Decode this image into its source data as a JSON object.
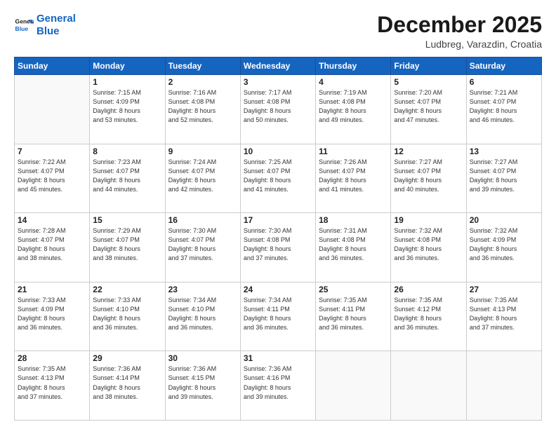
{
  "header": {
    "logo_line1": "General",
    "logo_line2": "Blue",
    "month": "December 2025",
    "location": "Ludbreg, Varazdin, Croatia"
  },
  "weekdays": [
    "Sunday",
    "Monday",
    "Tuesday",
    "Wednesday",
    "Thursday",
    "Friday",
    "Saturday"
  ],
  "weeks": [
    [
      {
        "day": "",
        "info": ""
      },
      {
        "day": "1",
        "info": "Sunrise: 7:15 AM\nSunset: 4:09 PM\nDaylight: 8 hours\nand 53 minutes."
      },
      {
        "day": "2",
        "info": "Sunrise: 7:16 AM\nSunset: 4:08 PM\nDaylight: 8 hours\nand 52 minutes."
      },
      {
        "day": "3",
        "info": "Sunrise: 7:17 AM\nSunset: 4:08 PM\nDaylight: 8 hours\nand 50 minutes."
      },
      {
        "day": "4",
        "info": "Sunrise: 7:19 AM\nSunset: 4:08 PM\nDaylight: 8 hours\nand 49 minutes."
      },
      {
        "day": "5",
        "info": "Sunrise: 7:20 AM\nSunset: 4:07 PM\nDaylight: 8 hours\nand 47 minutes."
      },
      {
        "day": "6",
        "info": "Sunrise: 7:21 AM\nSunset: 4:07 PM\nDaylight: 8 hours\nand 46 minutes."
      }
    ],
    [
      {
        "day": "7",
        "info": "Sunrise: 7:22 AM\nSunset: 4:07 PM\nDaylight: 8 hours\nand 45 minutes."
      },
      {
        "day": "8",
        "info": "Sunrise: 7:23 AM\nSunset: 4:07 PM\nDaylight: 8 hours\nand 44 minutes."
      },
      {
        "day": "9",
        "info": "Sunrise: 7:24 AM\nSunset: 4:07 PM\nDaylight: 8 hours\nand 42 minutes."
      },
      {
        "day": "10",
        "info": "Sunrise: 7:25 AM\nSunset: 4:07 PM\nDaylight: 8 hours\nand 41 minutes."
      },
      {
        "day": "11",
        "info": "Sunrise: 7:26 AM\nSunset: 4:07 PM\nDaylight: 8 hours\nand 41 minutes."
      },
      {
        "day": "12",
        "info": "Sunrise: 7:27 AM\nSunset: 4:07 PM\nDaylight: 8 hours\nand 40 minutes."
      },
      {
        "day": "13",
        "info": "Sunrise: 7:27 AM\nSunset: 4:07 PM\nDaylight: 8 hours\nand 39 minutes."
      }
    ],
    [
      {
        "day": "14",
        "info": "Sunrise: 7:28 AM\nSunset: 4:07 PM\nDaylight: 8 hours\nand 38 minutes."
      },
      {
        "day": "15",
        "info": "Sunrise: 7:29 AM\nSunset: 4:07 PM\nDaylight: 8 hours\nand 38 minutes."
      },
      {
        "day": "16",
        "info": "Sunrise: 7:30 AM\nSunset: 4:07 PM\nDaylight: 8 hours\nand 37 minutes."
      },
      {
        "day": "17",
        "info": "Sunrise: 7:30 AM\nSunset: 4:08 PM\nDaylight: 8 hours\nand 37 minutes."
      },
      {
        "day": "18",
        "info": "Sunrise: 7:31 AM\nSunset: 4:08 PM\nDaylight: 8 hours\nand 36 minutes."
      },
      {
        "day": "19",
        "info": "Sunrise: 7:32 AM\nSunset: 4:08 PM\nDaylight: 8 hours\nand 36 minutes."
      },
      {
        "day": "20",
        "info": "Sunrise: 7:32 AM\nSunset: 4:09 PM\nDaylight: 8 hours\nand 36 minutes."
      }
    ],
    [
      {
        "day": "21",
        "info": "Sunrise: 7:33 AM\nSunset: 4:09 PM\nDaylight: 8 hours\nand 36 minutes."
      },
      {
        "day": "22",
        "info": "Sunrise: 7:33 AM\nSunset: 4:10 PM\nDaylight: 8 hours\nand 36 minutes."
      },
      {
        "day": "23",
        "info": "Sunrise: 7:34 AM\nSunset: 4:10 PM\nDaylight: 8 hours\nand 36 minutes."
      },
      {
        "day": "24",
        "info": "Sunrise: 7:34 AM\nSunset: 4:11 PM\nDaylight: 8 hours\nand 36 minutes."
      },
      {
        "day": "25",
        "info": "Sunrise: 7:35 AM\nSunset: 4:11 PM\nDaylight: 8 hours\nand 36 minutes."
      },
      {
        "day": "26",
        "info": "Sunrise: 7:35 AM\nSunset: 4:12 PM\nDaylight: 8 hours\nand 36 minutes."
      },
      {
        "day": "27",
        "info": "Sunrise: 7:35 AM\nSunset: 4:13 PM\nDaylight: 8 hours\nand 37 minutes."
      }
    ],
    [
      {
        "day": "28",
        "info": "Sunrise: 7:35 AM\nSunset: 4:13 PM\nDaylight: 8 hours\nand 37 minutes."
      },
      {
        "day": "29",
        "info": "Sunrise: 7:36 AM\nSunset: 4:14 PM\nDaylight: 8 hours\nand 38 minutes."
      },
      {
        "day": "30",
        "info": "Sunrise: 7:36 AM\nSunset: 4:15 PM\nDaylight: 8 hours\nand 39 minutes."
      },
      {
        "day": "31",
        "info": "Sunrise: 7:36 AM\nSunset: 4:16 PM\nDaylight: 8 hours\nand 39 minutes."
      },
      {
        "day": "",
        "info": ""
      },
      {
        "day": "",
        "info": ""
      },
      {
        "day": "",
        "info": ""
      }
    ]
  ]
}
